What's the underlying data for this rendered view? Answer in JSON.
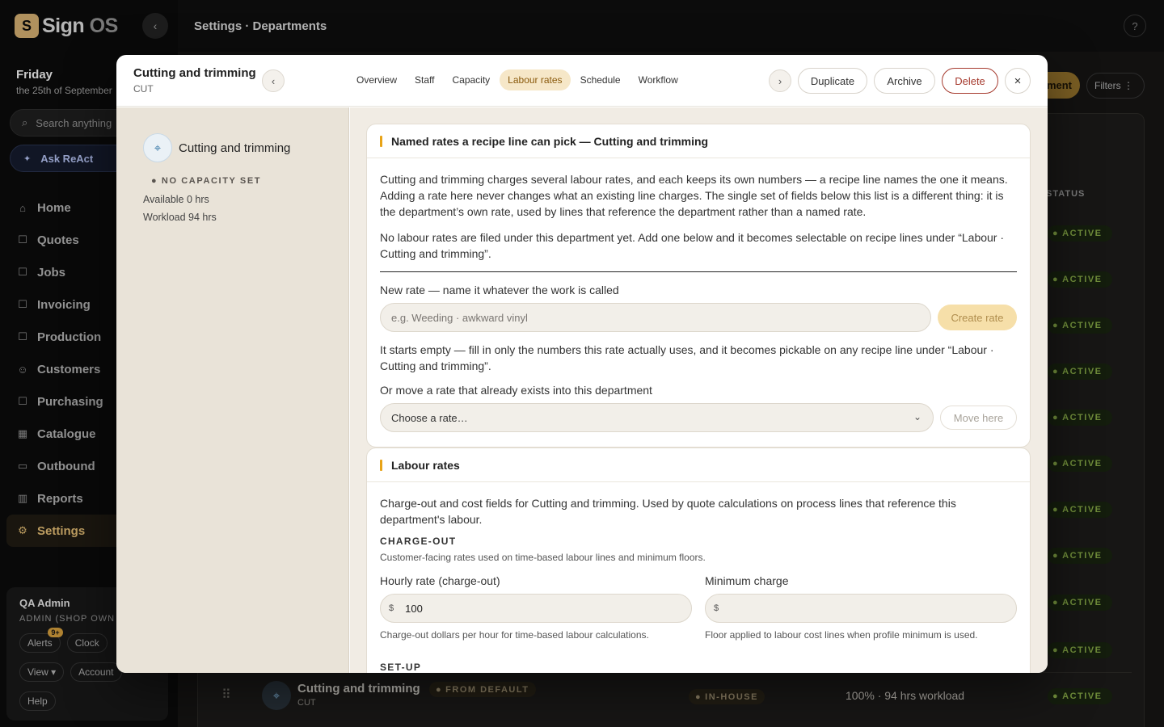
{
  "app": {
    "logo_text": "Sign",
    "logo_os": "OS",
    "page_title": "Settings · Departments"
  },
  "sidebar": {
    "day": "Friday",
    "date_sub": "the 25th of September",
    "search_placeholder": "Search anything",
    "ask_label": "Ask ReAct",
    "items": [
      {
        "label": "Home",
        "icon": "home-icon",
        "glyph": "⌂"
      },
      {
        "label": "Quotes",
        "icon": "quote-icon",
        "glyph": "☐"
      },
      {
        "label": "Jobs",
        "icon": "jobs-icon",
        "glyph": "☐"
      },
      {
        "label": "Invoicing",
        "icon": "invoice-icon",
        "glyph": "☐"
      },
      {
        "label": "Production",
        "icon": "production-icon",
        "glyph": "☐"
      },
      {
        "label": "Customers",
        "icon": "customers-icon",
        "glyph": "☺"
      },
      {
        "label": "Purchasing",
        "icon": "purchasing-icon",
        "glyph": "☐"
      },
      {
        "label": "Catalogue",
        "icon": "catalogue-icon",
        "glyph": "▦"
      },
      {
        "label": "Outbound",
        "icon": "outbound-icon",
        "glyph": "▭"
      },
      {
        "label": "Reports",
        "icon": "reports-icon",
        "glyph": "▥"
      },
      {
        "label": "Settings",
        "icon": "settings-icon",
        "glyph": "⚙"
      }
    ],
    "active_index": 10,
    "user": {
      "name": "QA Admin",
      "role": "ADMIN (SHOP OWN",
      "alerts": "Alerts",
      "alerts_badge": "9+",
      "clock": "Clock",
      "view": "View ▾",
      "account": "Account",
      "help": "Help"
    }
  },
  "background": {
    "add_dept_partial": "ment",
    "filters": "Filters ⋮",
    "status_header": "STATUS",
    "status_active": "ACTIVE",
    "row": {
      "name": "Cutting and trimming",
      "code": "CUT",
      "from_default": "FROM DEFAULT",
      "type": "IN-HOUSE",
      "workload": "100% · 94 hrs workload"
    }
  },
  "modal": {
    "title": "Cutting and trimming",
    "code": "CUT",
    "tabs": [
      "Overview",
      "Staff",
      "Capacity",
      "Labour rates",
      "Schedule",
      "Workflow"
    ],
    "active_tab": 3,
    "duplicate": "Duplicate",
    "archive": "Archive",
    "delete": "Delete",
    "close_glyph": "×",
    "prev_glyph": "‹",
    "next_glyph": "›",
    "left": {
      "dept_name": "Cutting and trimming",
      "capacity_tag": "● NO CAPACITY SET",
      "available": "Available 0 hrs",
      "workload": "Workload 94 hrs"
    },
    "named_rates": {
      "heading": "Named rates a recipe line can pick — Cutting and trimming",
      "intro": "Cutting and trimming charges several labour rates, and each keeps its own numbers — a recipe line names the one it means. Adding a rate here never changes what an existing line charges. The single set of fields below this list is a different thing: it is the department’s own rate, used by lines that reference the department rather than a named rate.",
      "empty": "No labour rates are filed under this department yet. Add one below and it becomes selectable on recipe lines under “Labour · Cutting and trimming”.",
      "new_label": "New rate — name it whatever the work is called",
      "new_placeholder": "e.g. Weeding · awkward vinyl",
      "create_btn": "Create rate",
      "starts_empty": "It starts empty — fill in only the numbers this rate actually uses, and it becomes pickable on any recipe line under “Labour · Cutting and trimming”.",
      "move_label": "Or move a rate that already exists into this department",
      "move_select": "Choose a rate…",
      "move_btn": "Move here"
    },
    "labour_rates": {
      "heading": "Labour rates",
      "intro": "Charge-out and cost fields for Cutting and trimming. Used by quote calculations on process lines that reference this department's labour.",
      "charge_out_cap": "CHARGE-OUT",
      "charge_out_sub": "Customer-facing rates used on time-based labour lines and minimum floors.",
      "hourly_label": "Hourly rate (charge-out)",
      "hourly_currency": "$",
      "hourly_value": "100",
      "hourly_hint": "Charge-out dollars per hour for time-based labour calculations.",
      "min_label": "Minimum charge",
      "min_currency": "$",
      "min_value": "",
      "min_hint": "Floor applied to labour cost lines when profile minimum is used.",
      "setup_cap": "SET-UP"
    }
  }
}
